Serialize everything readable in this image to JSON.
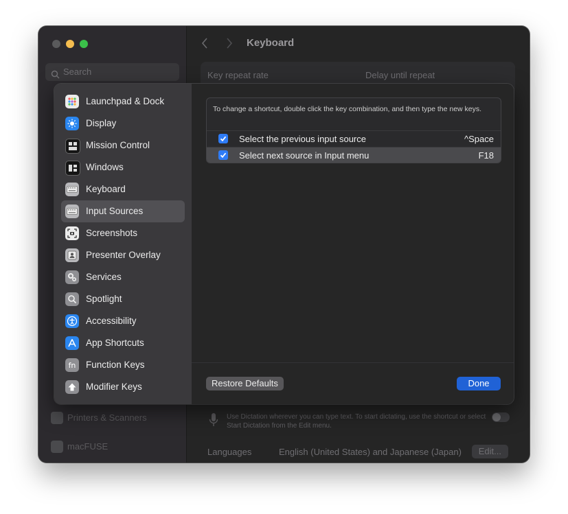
{
  "window": {
    "title": "Keyboard",
    "search_placeholder": "Search"
  },
  "background": {
    "sidebar_items": [
      "Printers & Scanners",
      "macFUSE"
    ],
    "panel_labels": {
      "key_repeat": "Key repeat rate",
      "delay_repeat": "Delay until repeat"
    },
    "dictation_text": "Use Dictation wherever you can type text. To start dictating, use the shortcut or select Start Dictation from the Edit menu.",
    "languages_label": "Languages",
    "languages_value": "English (United States) and Japanese (Japan)",
    "edit_label": "Edit..."
  },
  "sheet": {
    "categories": [
      {
        "label": "Launchpad & Dock",
        "icon": "launchpad-icon"
      },
      {
        "label": "Display",
        "icon": "display-icon"
      },
      {
        "label": "Mission Control",
        "icon": "mission-control-icon"
      },
      {
        "label": "Windows",
        "icon": "windows-icon"
      },
      {
        "label": "Keyboard",
        "icon": "keyboard-icon"
      },
      {
        "label": "Input Sources",
        "icon": "input-sources-icon",
        "selected": true
      },
      {
        "label": "Screenshots",
        "icon": "screenshot-icon"
      },
      {
        "label": "Presenter Overlay",
        "icon": "presenter-overlay-icon"
      },
      {
        "label": "Services",
        "icon": "services-icon"
      },
      {
        "label": "Spotlight",
        "icon": "spotlight-icon"
      },
      {
        "label": "Accessibility",
        "icon": "accessibility-icon"
      },
      {
        "label": "App Shortcuts",
        "icon": "app-shortcuts-icon"
      },
      {
        "label": "Function Keys",
        "icon": "function-keys-icon"
      },
      {
        "label": "Modifier Keys",
        "icon": "modifier-keys-icon"
      }
    ],
    "hint": "To change a shortcut, double click the key combination, and then type the new keys.",
    "shortcuts": [
      {
        "label": "Select the previous input source",
        "key": "^Space",
        "checked": true
      },
      {
        "label": "Select next source in Input menu",
        "key": "F18",
        "checked": true
      }
    ],
    "restore_label": "Restore Defaults",
    "done_label": "Done",
    "fn_glyph": "fn"
  },
  "colors": {
    "accent": "#2062d6",
    "checkbox": "#2f7cf6",
    "selected_row": "#515054"
  }
}
